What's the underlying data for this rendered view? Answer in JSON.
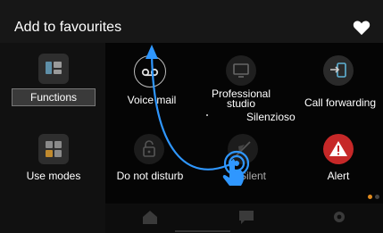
{
  "header": {
    "title": "Add to favourites",
    "favourite_icon": "heart-icon"
  },
  "sidebar": {
    "items": [
      {
        "label": "Functions",
        "icon": "functions-icon",
        "active": true
      },
      {
        "label": "Use modes",
        "icon": "use-modes-icon",
        "active": false
      }
    ]
  },
  "grid": {
    "items": [
      {
        "label": "Voice mail",
        "icon": "voicemail-icon"
      },
      {
        "label": "Professional studio",
        "icon": "monitor-icon"
      },
      {
        "label": "Call forwarding",
        "icon": "call-forwarding-icon"
      },
      {
        "label": "Do not disturb",
        "icon": "lock-icon"
      },
      {
        "label": "Silent",
        "icon": "mute-icon"
      },
      {
        "label": "Alert",
        "icon": "alert-icon"
      }
    ]
  },
  "overlay": {
    "text": "Silenzioso",
    "gesture": "drag-gesture-hand-icon"
  },
  "bottom_bar": {
    "icons": [
      "home-icon",
      "chat-icon",
      "settings-icon"
    ]
  },
  "colors": {
    "accent_blue": "#2f97ff",
    "alert_red": "#c62828",
    "pager_orange": "#e08a1e"
  }
}
